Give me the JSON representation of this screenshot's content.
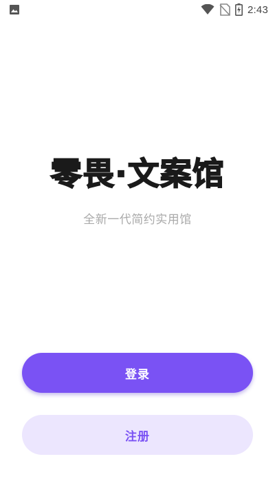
{
  "status_bar": {
    "time": "2:43",
    "icons": [
      "image-notification-icon",
      "wifi-icon",
      "no-sim-icon",
      "battery-charging-icon"
    ]
  },
  "app": {
    "title": "零畏·文案馆",
    "subtitle": "全新一代简约实用馆"
  },
  "actions": {
    "login_label": "登录",
    "register_label": "注册"
  },
  "colors": {
    "accent": "#7a52f4",
    "accent_light": "#ece6fe",
    "title": "#1a1a1a",
    "subtitle": "#aaaaaa"
  }
}
